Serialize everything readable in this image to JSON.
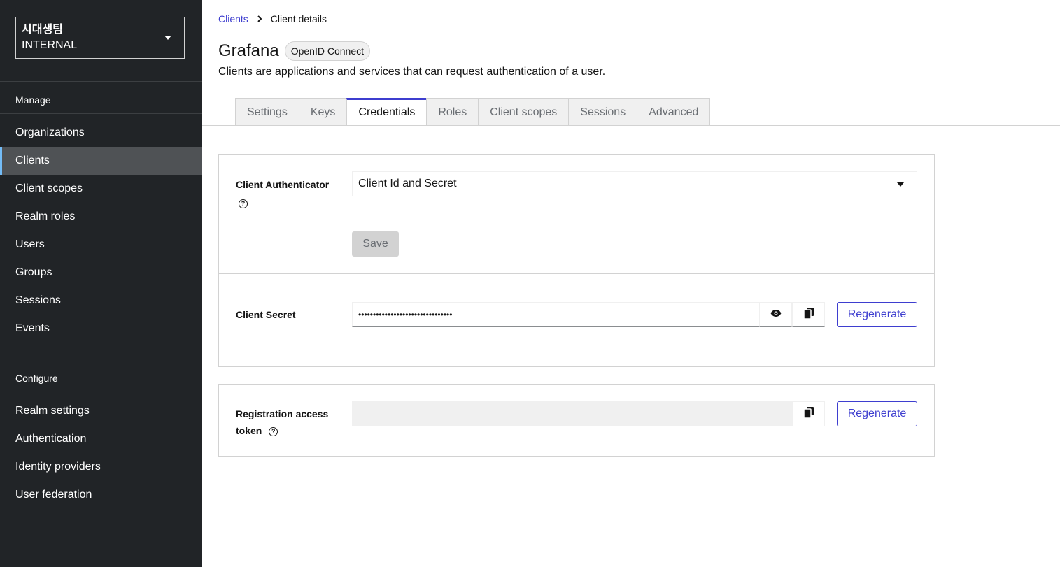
{
  "sidebar": {
    "realm_name": "시대생팀",
    "realm_type": "INTERNAL",
    "manage_label": "Manage",
    "manage_items": [
      {
        "label": "Organizations"
      },
      {
        "label": "Clients"
      },
      {
        "label": "Client scopes"
      },
      {
        "label": "Realm roles"
      },
      {
        "label": "Users"
      },
      {
        "label": "Groups"
      },
      {
        "label": "Sessions"
      },
      {
        "label": "Events"
      }
    ],
    "configure_label": "Configure",
    "configure_items": [
      {
        "label": "Realm settings"
      },
      {
        "label": "Authentication"
      },
      {
        "label": "Identity providers"
      },
      {
        "label": "User federation"
      }
    ],
    "active_item": "Clients"
  },
  "breadcrumb": {
    "link": "Clients",
    "current": "Client details"
  },
  "header": {
    "title": "Grafana",
    "badge": "OpenID Connect",
    "description": "Clients are applications and services that can request authentication of a user."
  },
  "tabs": [
    {
      "label": "Settings"
    },
    {
      "label": "Keys"
    },
    {
      "label": "Credentials"
    },
    {
      "label": "Roles"
    },
    {
      "label": "Client scopes"
    },
    {
      "label": "Sessions"
    },
    {
      "label": "Advanced"
    }
  ],
  "active_tab": "Credentials",
  "credentials": {
    "authenticator_label": "Client Authenticator",
    "authenticator_value": "Client Id and Secret",
    "save_label": "Save",
    "secret_label": "Client Secret",
    "secret_value": "••••••••••••••••••••••••••••••••",
    "regenerate_label": "Regenerate",
    "rat_label_line1": "Registration access",
    "rat_label_line2": "token",
    "rat_value": "",
    "rat_regenerate_label": "Regenerate"
  },
  "colors": {
    "sidebar_bg": "#212427",
    "accent": "#3e3ecf",
    "active_nav_indicator": "#73bcf7"
  }
}
